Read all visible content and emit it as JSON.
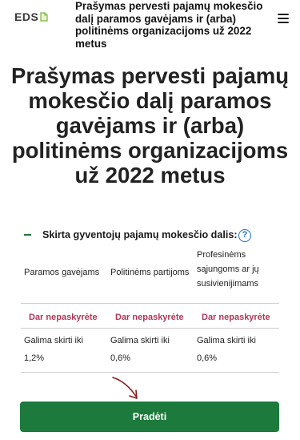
{
  "header": {
    "logo_text": "EDS",
    "title": "Prašymas pervesti pajamų mokesčio dalį paramos gavėjams ir (arba) politinėms organizacijoms už 2022 metus"
  },
  "page": {
    "title": "Prašymas pervesti pajamų mokesčio dalį paramos gavėjams ir (arba) politinėms organizacijoms už 2022 metus"
  },
  "section": {
    "label": "Skirta gyventojų pajamų mokesčio dalis:",
    "help_symbol": "?"
  },
  "table": {
    "columns": [
      {
        "header": "Paramos gavėjams",
        "status": "Dar nepaskyrėte",
        "limit_label": "Galima skirti iki",
        "limit_value": "1,2%"
      },
      {
        "header": "Politinėms partijoms",
        "status": "Dar nepaskyrėte",
        "limit_label": "Galima skirti iki",
        "limit_value": "0,6%"
      },
      {
        "header": "Profesinėms sąjungoms ar jų susivienijimams",
        "status": "Dar nepaskyrėte",
        "limit_label": "Galima skirti iki",
        "limit_value": "0,6%"
      }
    ]
  },
  "actions": {
    "start_label": "Pradėti"
  },
  "colors": {
    "accent": "#1b7a3c",
    "status": "#b0365b",
    "help": "#1a6fc0"
  }
}
